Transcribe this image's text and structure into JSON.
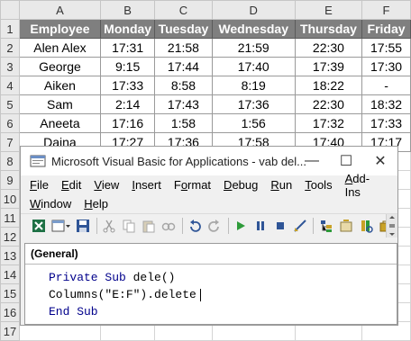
{
  "sheet": {
    "column_letters": [
      "A",
      "B",
      "C",
      "D",
      "E",
      "F"
    ],
    "headers": [
      "Employee",
      "Monday",
      "Tuesday",
      "Wednesday",
      "Thursday",
      "Friday"
    ],
    "rows": [
      [
        "Alen Alex",
        "17:31",
        "21:58",
        "21:59",
        "22:30",
        "17:55"
      ],
      [
        "George",
        "9:15",
        "17:44",
        "17:40",
        "17:39",
        "17:30"
      ],
      [
        "Aiken",
        "17:33",
        "8:58",
        "8:19",
        "18:22",
        "-"
      ],
      [
        "Sam",
        "2:14",
        "17:43",
        "17:36",
        "22:30",
        "18:32"
      ],
      [
        "Aneeta",
        "17:16",
        "1:58",
        "1:56",
        "17:32",
        "17:33"
      ],
      [
        "Daina",
        "17:27",
        "17:36",
        "17:58",
        "17:40",
        "17:17"
      ]
    ],
    "row_numbers": [
      "1",
      "2",
      "3",
      "4",
      "5",
      "6",
      "7",
      "8",
      "9",
      "10",
      "11",
      "12",
      "13",
      "14",
      "15",
      "16",
      "17"
    ]
  },
  "vbe": {
    "title": "Microsoft Visual Basic for Applications - vab del...",
    "window_controls": {
      "minimize": "—",
      "maximize": "☐",
      "close": "✕"
    },
    "menus_row1": [
      {
        "pre": "",
        "u": "F",
        "post": "ile"
      },
      {
        "pre": "",
        "u": "E",
        "post": "dit"
      },
      {
        "pre": "",
        "u": "V",
        "post": "iew"
      },
      {
        "pre": "",
        "u": "I",
        "post": "nsert"
      },
      {
        "pre": "F",
        "u": "o",
        "post": "rmat"
      },
      {
        "pre": "",
        "u": "D",
        "post": "ebug"
      },
      {
        "pre": "",
        "u": "R",
        "post": "un"
      },
      {
        "pre": "",
        "u": "T",
        "post": "ools"
      },
      {
        "pre": "",
        "u": "A",
        "post": "dd-Ins"
      }
    ],
    "menus_row2": [
      {
        "pre": "",
        "u": "W",
        "post": "indow"
      },
      {
        "pre": "",
        "u": "H",
        "post": "elp"
      }
    ],
    "code_dropdown": "(General)",
    "code": {
      "line1_kw": "Private Sub",
      "line1_rest": " dele()",
      "line2": "Columns(\"E:F\").delete",
      "line3_kw": "End Sub"
    },
    "colors": {
      "keyword": "#00008b",
      "header_fill": "#7f7f7f"
    }
  }
}
